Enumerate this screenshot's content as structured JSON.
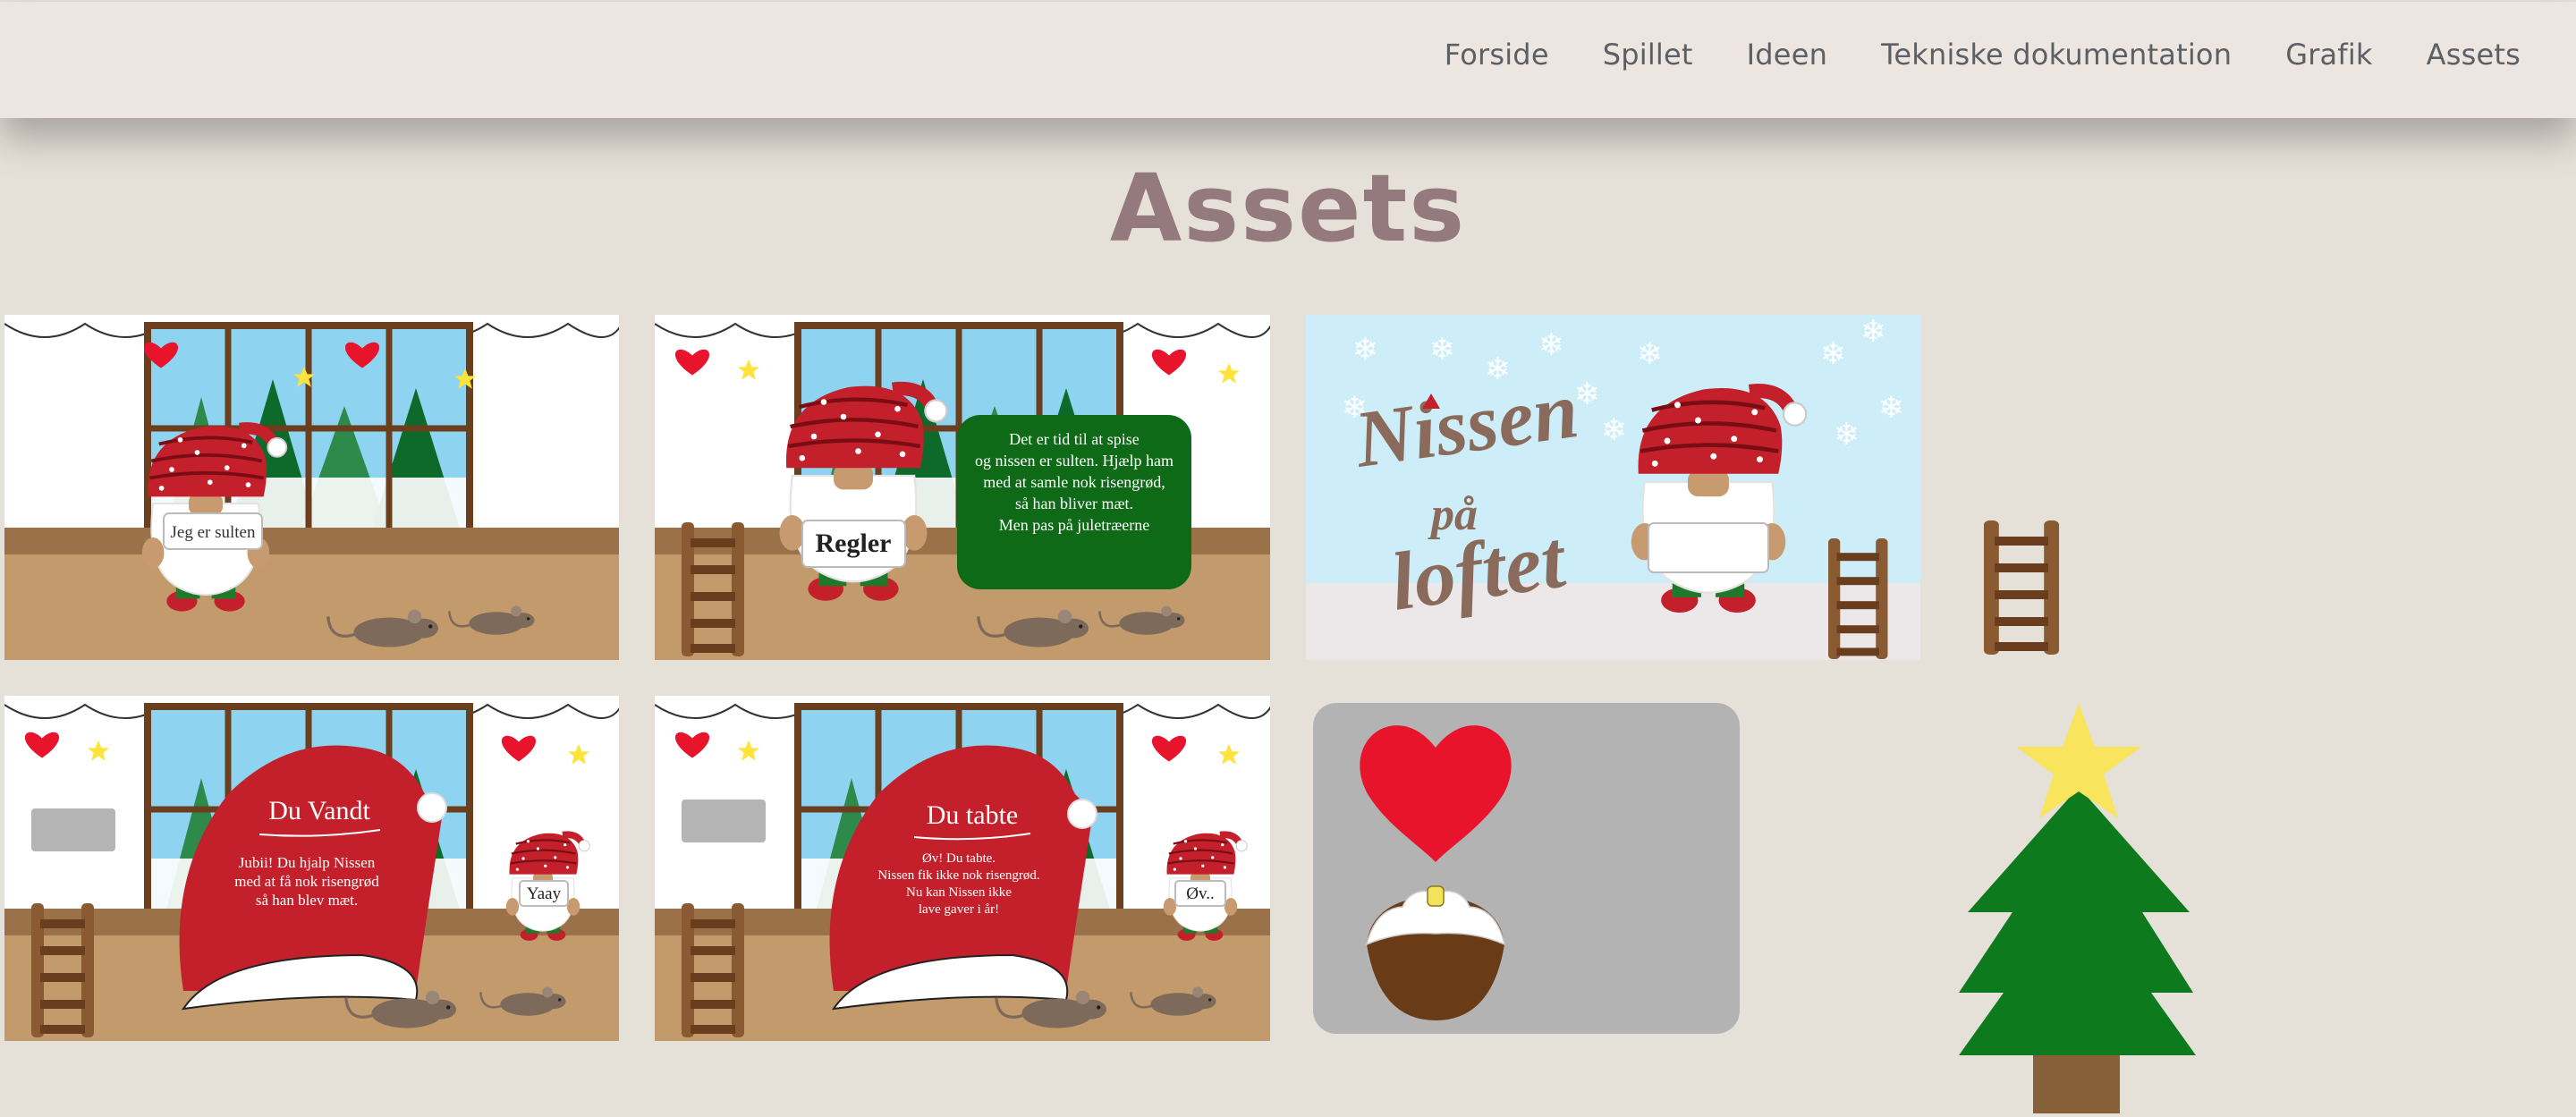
{
  "nav": {
    "items": [
      {
        "label": "Forside"
      },
      {
        "label": "Spillet"
      },
      {
        "label": "Ideen"
      },
      {
        "label": "Tekniske dokumentation"
      },
      {
        "label": "Grafik"
      },
      {
        "label": "Assets"
      }
    ]
  },
  "page": {
    "title": "Assets"
  },
  "assets": {
    "scene_hungry": {
      "sign": "Jeg er sulten"
    },
    "scene_rules": {
      "sign": "Regler",
      "rules_lines": [
        "Det er tid til at spise",
        "og nissen er sulten. Hjælp ham",
        "med at samle nok risengrød,",
        "så han bliver mæt.",
        "Men pas på juletræerne"
      ]
    },
    "title_card": {
      "title_line1": "Nissen",
      "title_line2": "på",
      "title_line3": "loftet"
    },
    "scene_win": {
      "heading": "Du Vandt",
      "lines": [
        "Jubii! Du hjalp Nissen",
        "med at få nok risengrød",
        "så han blev mæt."
      ],
      "sign": "Yaay"
    },
    "scene_lose": {
      "heading": "Du tabte",
      "lines": [
        "Øv! Du tabte.",
        "Nissen fik ikke nok risengrød.",
        "Nu kan Nissen ikke",
        "lave gaver i år!"
      ],
      "sign": "Øv.."
    }
  },
  "colors": {
    "nav_bg": "#ede5df",
    "page_bg": "#e5e1d8",
    "title": "#957a7d",
    "nav_text": "#5b5f66",
    "gnome_red": "#c4202b",
    "tree_green": "#0e7a1e",
    "floor": "#c39a6b",
    "rules_box": "#0e6a16"
  }
}
